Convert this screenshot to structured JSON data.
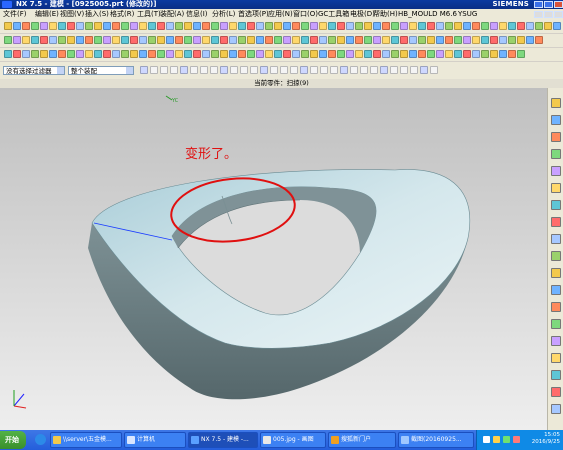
{
  "window": {
    "title": "NX 7.5 - 建模 - [0925005.prt (修改的)]",
    "brand": "SIEMENS"
  },
  "menu": [
    "文件(F)",
    "编辑(E)",
    "视图(V)",
    "插入(S)",
    "格式(R)",
    "工具(T)",
    "装配(A)",
    "信息(I)",
    "分析(L)",
    "首选项(P)",
    "应用(N)",
    "窗口(O)",
    "GC工具箱",
    "电极(D)",
    "帮助(H)",
    "HB_MOULD M6.6",
    "YSUG"
  ],
  "selection_bar": {
    "filter": "没有选择过滤器",
    "scope": "整个装配"
  },
  "cue_line": "当前零件：扫掠(9)",
  "annotation": {
    "text": "变形了。",
    "color": "#e01010"
  },
  "model": {
    "face_color": "#cfe4ea",
    "side_color": "#6f8387"
  },
  "taskbar": {
    "start": "开始",
    "tasks": [
      "\\\\server\\五金模...",
      "计算机",
      "NX 7.5 - 建模 -...",
      "005.jpg - 画图",
      "搜狐新门户",
      "截图(20160925..."
    ],
    "clock_time": "15:05",
    "clock_date": "2016/9/25"
  }
}
